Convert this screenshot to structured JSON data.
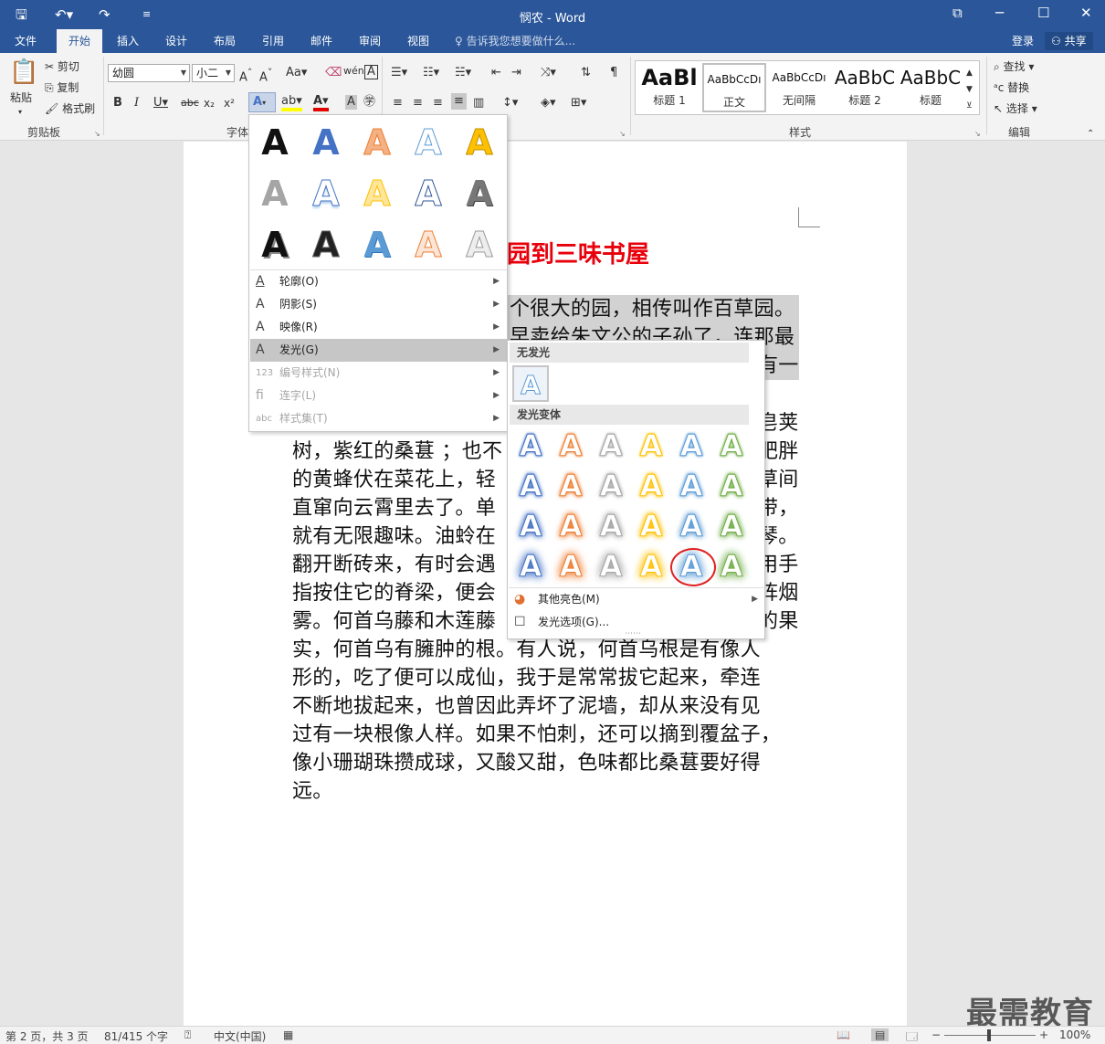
{
  "window": {
    "title": "悯农 - Word"
  },
  "tabs": [
    {
      "label": "文件"
    },
    {
      "label": "开始"
    },
    {
      "label": "插入"
    },
    {
      "label": "设计"
    },
    {
      "label": "布局"
    },
    {
      "label": "引用"
    },
    {
      "label": "邮件"
    },
    {
      "label": "审阅"
    },
    {
      "label": "视图"
    }
  ],
  "tellme": "告诉我您想要做什么...",
  "account": {
    "login": "登录",
    "share": "共享"
  },
  "clipboard": {
    "paste": "粘贴",
    "cut": "剪切",
    "copy": "复制",
    "format_painter": "格式刷",
    "group": "剪贴板"
  },
  "font": {
    "name": "幼圆",
    "size": "小二",
    "group": "字体"
  },
  "styles": {
    "items": [
      {
        "preview": "AaBl",
        "name": "标题 1"
      },
      {
        "preview": "AaBbCcDı",
        "name": "正文"
      },
      {
        "preview": "AaBbCcDı",
        "name": "无间隔"
      },
      {
        "preview": "AaBbC",
        "name": "标题 2"
      },
      {
        "preview": "AaBbC",
        "name": "标题"
      }
    ],
    "group": "样式"
  },
  "editing": {
    "find": "查找",
    "replace": "替换",
    "select": "选择",
    "group": "编辑"
  },
  "document": {
    "heading": "园到三味书屋",
    "lines": [
      "个很大的园，相传叫作百草园。",
      "早卖给朱文公的子孙了，连那最",
      "有一",
      "皂荚",
      "树，紫红的桑葚 ；也不",
      "肥胖",
      "的黄蜂伏在菜花上，轻",
      "草间",
      "直窜向云霄里去了。单",
      "带，",
      "就有无限趣味。油蛉在",
      "琴。",
      "翻开断砖来，有时会遇",
      "用手",
      "指按住它的脊梁，便会",
      "阵烟",
      "雾。何首乌藤和木莲藤",
      "的果",
      "实，何首乌有臃肿的根。有人说，何首乌根是有像人",
      "形的，吃了便可以成仙，我于是常常拔它起来，牵连",
      "不断地拔起来，也曾因此弄坏了泥墙，却从来没有见",
      "过有一块根像人样。如果不怕刺，还可以摘到覆盆子，",
      "像小珊瑚珠攒成球，又酸又甜，色味都比桑葚要好得",
      "远。"
    ]
  },
  "text_effects_menu": {
    "items": [
      {
        "label": "轮廓(O)"
      },
      {
        "label": "阴影(S)"
      },
      {
        "label": "映像(R)"
      },
      {
        "label": "发光(G)"
      },
      {
        "label": "编号样式(N)"
      },
      {
        "label": "连字(L)"
      },
      {
        "label": "样式集(T)"
      }
    ]
  },
  "glow_submenu": {
    "no_glow": "无发光",
    "variants": "发光变体",
    "more_colors": "其他亮色(M)",
    "options": "发光选项(G)...",
    "colors": [
      "#4472c4",
      "#ed7d31",
      "#a5a5a5",
      "#ffc000",
      "#5b9bd5",
      "#70ad47"
    ]
  },
  "status": {
    "page": "第 2 页，共 3 页",
    "words": "81/415 个字",
    "lang": "中文(中国)",
    "zoom": "100%"
  },
  "watermark": "最需教育"
}
